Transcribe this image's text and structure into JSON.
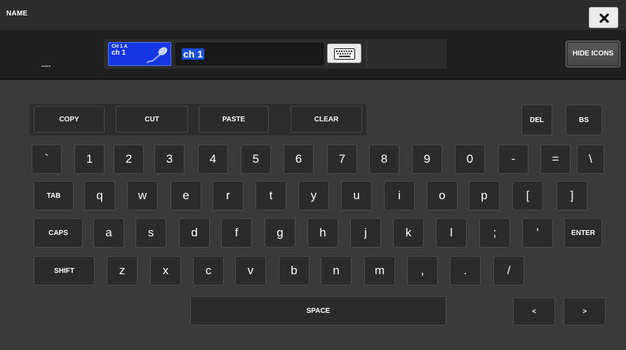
{
  "window": {
    "title": "NAME",
    "close_icon": "close-icon"
  },
  "namebar": {
    "dashes": "----",
    "channel_id": "CH 1 A",
    "channel_short": "ch 1",
    "channel_icon": "microphone-icon",
    "channel_color": "#1437e3",
    "name_value": "ch 1",
    "keyboard_icon": "keyboard-icon",
    "hide_icons_label": "HIDE ICONS"
  },
  "edit_keys": {
    "copy": "COPY",
    "cut": "CUT",
    "paste": "PASTE",
    "clear": "CLEAR",
    "del": "DEL",
    "bs": "BS"
  },
  "keyboard": {
    "row1": [
      "`",
      "1",
      "2",
      "3",
      "4",
      "5",
      "6",
      "7",
      "8",
      "9",
      "0",
      "-",
      "=",
      "\\"
    ],
    "row2": [
      "TAB",
      "q",
      "w",
      "e",
      "r",
      "t",
      "y",
      "u",
      "i",
      "o",
      "p",
      "[",
      "]"
    ],
    "row3": [
      "CAPS",
      "a",
      "s",
      "d",
      "f",
      "g",
      "h",
      "j",
      "k",
      "l",
      ";",
      "'",
      "ENTER"
    ],
    "row4": [
      "SHIFT",
      "z",
      "x",
      "c",
      "v",
      "b",
      "n",
      "m",
      ",",
      ".",
      "/"
    ],
    "space": "SPACE",
    "left": "<",
    "right": ">"
  }
}
